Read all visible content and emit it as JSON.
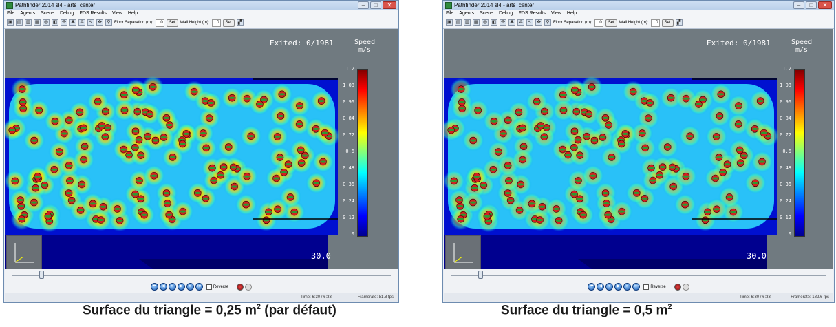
{
  "windows": [
    {
      "title": "Pathfinder 2014 sl4 - arts_center",
      "menu": [
        "File",
        "Agents",
        "Scene",
        "Debug",
        "FDS Results",
        "View",
        "Help"
      ],
      "toolbar": {
        "floor_sep_label": "Floor Separation (m):",
        "floor_sep_value": "0",
        "set_label": "Set",
        "wall_height_label": "Wall Height (m):",
        "wall_height_value": "0"
      },
      "exited": "Exited:  0/1981",
      "speed_title": "Speed",
      "speed_unit": "m/s",
      "ticks": [
        "1.2",
        "1.08",
        "0.96",
        "0.84",
        "0.72",
        "0.6",
        "0.48",
        "0.36",
        "0.24",
        "0.12",
        "0"
      ],
      "time_display": "30.0",
      "reverse_label": "Reverse",
      "status_time": "Time: 6:30 / 6:33",
      "status_fps": "Framerate: 81.8 fps",
      "heat_intensity": 0.85
    },
    {
      "title": "Pathfinder 2014 sl4 - arts_center",
      "menu": [
        "File",
        "Agents",
        "Scene",
        "Debug",
        "FDS Results",
        "View",
        "Help"
      ],
      "toolbar": {
        "floor_sep_label": "Floor Separation (m):",
        "floor_sep_value": "0",
        "set_label": "Set",
        "wall_height_label": "Wall Height (m):",
        "wall_height_value": "0"
      },
      "exited": "Exited:  0/1981",
      "speed_title": "Speed",
      "speed_unit": "m/s",
      "ticks": [
        "1.2",
        "1.08",
        "0.96",
        "0.84",
        "0.72",
        "0.6",
        "0.48",
        "0.36",
        "0.24",
        "0.12",
        "0"
      ],
      "time_display": "30.0",
      "reverse_label": "Reverse",
      "status_time": "Time: 6:30 / 6:33",
      "status_fps": "Framerate: 182.6 fps",
      "heat_intensity": 0.55
    }
  ],
  "captions": {
    "left": {
      "text": "Surface du triangle = 0,25 m",
      "sup": "2",
      "suffix": " (par défaut)"
    },
    "right": {
      "text": "Surface du triangle = 0,5 m",
      "sup": "2",
      "suffix": ""
    }
  },
  "colors": {
    "viewport_bg": "#707a80",
    "floor_base": "#00008f",
    "agent_red": "#d42020",
    "agent_green": "#2e9a2e"
  }
}
